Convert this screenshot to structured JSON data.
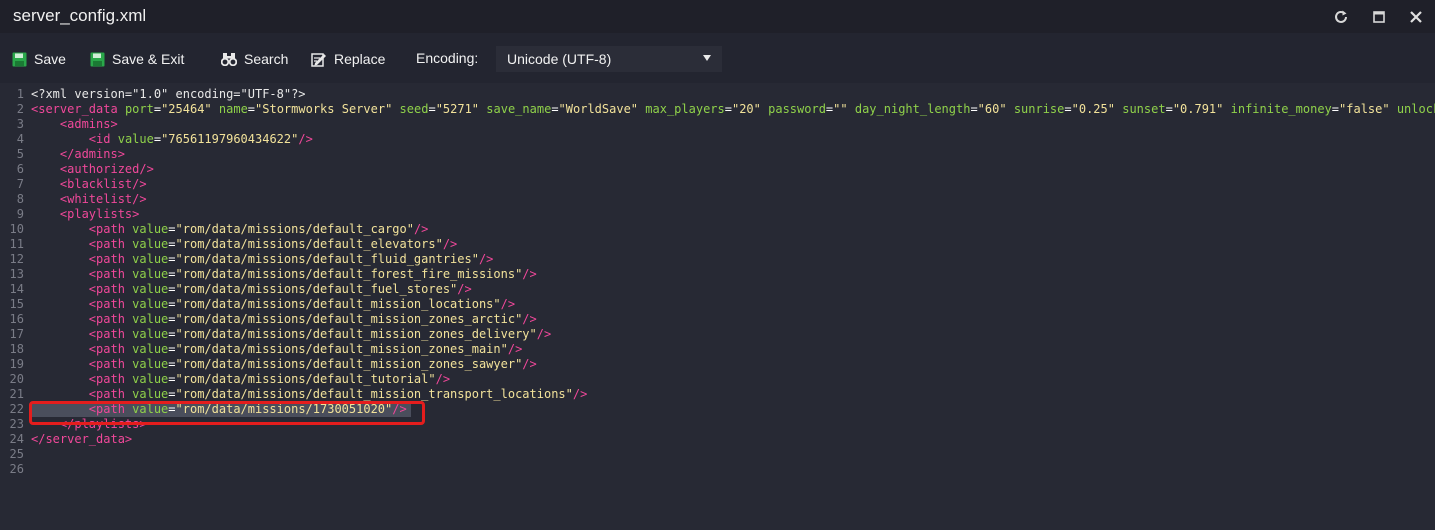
{
  "window": {
    "title": "server_config.xml",
    "controls": {
      "refresh": "refresh-icon",
      "maximize": "maximize-icon",
      "close": "close-icon"
    }
  },
  "toolbar": {
    "save_label": "Save",
    "save_exit_label": "Save & Exit",
    "search_label": "Search",
    "replace_label": "Replace",
    "encoding_label": "Encoding:",
    "encoding_value": "Unicode (UTF-8)"
  },
  "colors": {
    "tag": "#f0489a",
    "attribute": "#8fd14a",
    "value": "#f2e29a",
    "highlight_box": "#e41d1d"
  },
  "editor": {
    "highlighted_line": 22,
    "lines": [
      {
        "n": "1",
        "t": [
          [
            "pi",
            "<?xml version=\"1.0\" encoding=\"UTF-8\"?>"
          ]
        ]
      },
      {
        "n": "2",
        "t": [
          [
            "tag",
            "<server_data"
          ],
          [
            "txt",
            " "
          ],
          [
            "attr",
            "port"
          ],
          [
            "eq",
            "="
          ],
          [
            "val",
            "\"25464\""
          ],
          [
            "txt",
            " "
          ],
          [
            "attr",
            "name"
          ],
          [
            "eq",
            "="
          ],
          [
            "val",
            "\"Stormworks Server\""
          ],
          [
            "txt",
            " "
          ],
          [
            "attr",
            "seed"
          ],
          [
            "eq",
            "="
          ],
          [
            "val",
            "\"5271\""
          ],
          [
            "txt",
            " "
          ],
          [
            "attr",
            "save_name"
          ],
          [
            "eq",
            "="
          ],
          [
            "val",
            "\"WorldSave\""
          ],
          [
            "txt",
            " "
          ],
          [
            "attr",
            "max_players"
          ],
          [
            "eq",
            "="
          ],
          [
            "val",
            "\"20\""
          ],
          [
            "txt",
            " "
          ],
          [
            "attr",
            "password"
          ],
          [
            "eq",
            "="
          ],
          [
            "val",
            "\"\""
          ],
          [
            "txt",
            " "
          ],
          [
            "attr",
            "day_night_length"
          ],
          [
            "eq",
            "="
          ],
          [
            "val",
            "\"60\""
          ],
          [
            "txt",
            " "
          ],
          [
            "attr",
            "sunrise"
          ],
          [
            "eq",
            "="
          ],
          [
            "val",
            "\"0.25\""
          ],
          [
            "txt",
            " "
          ],
          [
            "attr",
            "sunset"
          ],
          [
            "eq",
            "="
          ],
          [
            "val",
            "\"0.791\""
          ],
          [
            "txt",
            " "
          ],
          [
            "attr",
            "infinite_money"
          ],
          [
            "eq",
            "="
          ],
          [
            "val",
            "\"false\""
          ],
          [
            "txt",
            " "
          ],
          [
            "attr",
            "unlock_a"
          ]
        ]
      },
      {
        "n": "3",
        "t": [
          [
            "txt",
            "    "
          ],
          [
            "tag",
            "<admins>"
          ]
        ]
      },
      {
        "n": "4",
        "t": [
          [
            "txt",
            "        "
          ],
          [
            "tag",
            "<id"
          ],
          [
            "txt",
            " "
          ],
          [
            "attr",
            "value"
          ],
          [
            "eq",
            "="
          ],
          [
            "val",
            "\"76561197960434622\""
          ],
          [
            "tag",
            "/>"
          ]
        ]
      },
      {
        "n": "5",
        "t": [
          [
            "txt",
            "    "
          ],
          [
            "tag",
            "</admins>"
          ]
        ]
      },
      {
        "n": "6",
        "t": [
          [
            "txt",
            "    "
          ],
          [
            "tag",
            "<authorized/>"
          ]
        ]
      },
      {
        "n": "7",
        "t": [
          [
            "txt",
            "    "
          ],
          [
            "tag",
            "<blacklist/>"
          ]
        ]
      },
      {
        "n": "8",
        "t": [
          [
            "txt",
            "    "
          ],
          [
            "tag",
            "<whitelist/>"
          ]
        ]
      },
      {
        "n": "9",
        "t": [
          [
            "txt",
            "    "
          ],
          [
            "tag",
            "<playlists>"
          ]
        ]
      },
      {
        "n": "10",
        "t": [
          [
            "txt",
            "        "
          ],
          [
            "tag",
            "<path"
          ],
          [
            "txt",
            " "
          ],
          [
            "attr",
            "value"
          ],
          [
            "eq",
            "="
          ],
          [
            "val",
            "\"rom/data/missions/default_cargo\""
          ],
          [
            "tag",
            "/>"
          ]
        ]
      },
      {
        "n": "11",
        "t": [
          [
            "txt",
            "        "
          ],
          [
            "tag",
            "<path"
          ],
          [
            "txt",
            " "
          ],
          [
            "attr",
            "value"
          ],
          [
            "eq",
            "="
          ],
          [
            "val",
            "\"rom/data/missions/default_elevators\""
          ],
          [
            "tag",
            "/>"
          ]
        ]
      },
      {
        "n": "12",
        "t": [
          [
            "txt",
            "        "
          ],
          [
            "tag",
            "<path"
          ],
          [
            "txt",
            " "
          ],
          [
            "attr",
            "value"
          ],
          [
            "eq",
            "="
          ],
          [
            "val",
            "\"rom/data/missions/default_fluid_gantries\""
          ],
          [
            "tag",
            "/>"
          ]
        ]
      },
      {
        "n": "13",
        "t": [
          [
            "txt",
            "        "
          ],
          [
            "tag",
            "<path"
          ],
          [
            "txt",
            " "
          ],
          [
            "attr",
            "value"
          ],
          [
            "eq",
            "="
          ],
          [
            "val",
            "\"rom/data/missions/default_forest_fire_missions\""
          ],
          [
            "tag",
            "/>"
          ]
        ]
      },
      {
        "n": "14",
        "t": [
          [
            "txt",
            "        "
          ],
          [
            "tag",
            "<path"
          ],
          [
            "txt",
            " "
          ],
          [
            "attr",
            "value"
          ],
          [
            "eq",
            "="
          ],
          [
            "val",
            "\"rom/data/missions/default_fuel_stores\""
          ],
          [
            "tag",
            "/>"
          ]
        ]
      },
      {
        "n": "15",
        "t": [
          [
            "txt",
            "        "
          ],
          [
            "tag",
            "<path"
          ],
          [
            "txt",
            " "
          ],
          [
            "attr",
            "value"
          ],
          [
            "eq",
            "="
          ],
          [
            "val",
            "\"rom/data/missions/default_mission_locations\""
          ],
          [
            "tag",
            "/>"
          ]
        ]
      },
      {
        "n": "16",
        "t": [
          [
            "txt",
            "        "
          ],
          [
            "tag",
            "<path"
          ],
          [
            "txt",
            " "
          ],
          [
            "attr",
            "value"
          ],
          [
            "eq",
            "="
          ],
          [
            "val",
            "\"rom/data/missions/default_mission_zones_arctic\""
          ],
          [
            "tag",
            "/>"
          ]
        ]
      },
      {
        "n": "17",
        "t": [
          [
            "txt",
            "        "
          ],
          [
            "tag",
            "<path"
          ],
          [
            "txt",
            " "
          ],
          [
            "attr",
            "value"
          ],
          [
            "eq",
            "="
          ],
          [
            "val",
            "\"rom/data/missions/default_mission_zones_delivery\""
          ],
          [
            "tag",
            "/>"
          ]
        ]
      },
      {
        "n": "18",
        "t": [
          [
            "txt",
            "        "
          ],
          [
            "tag",
            "<path"
          ],
          [
            "txt",
            " "
          ],
          [
            "attr",
            "value"
          ],
          [
            "eq",
            "="
          ],
          [
            "val",
            "\"rom/data/missions/default_mission_zones_main\""
          ],
          [
            "tag",
            "/>"
          ]
        ]
      },
      {
        "n": "19",
        "t": [
          [
            "txt",
            "        "
          ],
          [
            "tag",
            "<path"
          ],
          [
            "txt",
            " "
          ],
          [
            "attr",
            "value"
          ],
          [
            "eq",
            "="
          ],
          [
            "val",
            "\"rom/data/missions/default_mission_zones_sawyer\""
          ],
          [
            "tag",
            "/>"
          ]
        ]
      },
      {
        "n": "20",
        "t": [
          [
            "txt",
            "        "
          ],
          [
            "tag",
            "<path"
          ],
          [
            "txt",
            " "
          ],
          [
            "attr",
            "value"
          ],
          [
            "eq",
            "="
          ],
          [
            "val",
            "\"rom/data/missions/default_tutorial\""
          ],
          [
            "tag",
            "/>"
          ]
        ]
      },
      {
        "n": "21",
        "t": [
          [
            "txt",
            "        "
          ],
          [
            "tag",
            "<path"
          ],
          [
            "txt",
            " "
          ],
          [
            "attr",
            "value"
          ],
          [
            "eq",
            "="
          ],
          [
            "val",
            "\"rom/data/missions/default_mission_transport_locations\""
          ],
          [
            "tag",
            "/>"
          ]
        ]
      },
      {
        "n": "22",
        "t": [
          [
            "txt",
            "        "
          ],
          [
            "tag",
            "<path"
          ],
          [
            "txt",
            " "
          ],
          [
            "attr",
            "value"
          ],
          [
            "eq",
            "="
          ],
          [
            "val",
            "\"rom/data/missions/1730051020\""
          ],
          [
            "tag",
            "/>"
          ]
        ]
      },
      {
        "n": "23",
        "t": [
          [
            "txt",
            "    "
          ],
          [
            "tag",
            "</playlists>"
          ]
        ]
      },
      {
        "n": "24",
        "t": [
          [
            "tag",
            "</server_data>"
          ]
        ]
      },
      {
        "n": "25",
        "t": []
      },
      {
        "n": "26",
        "t": []
      }
    ]
  }
}
